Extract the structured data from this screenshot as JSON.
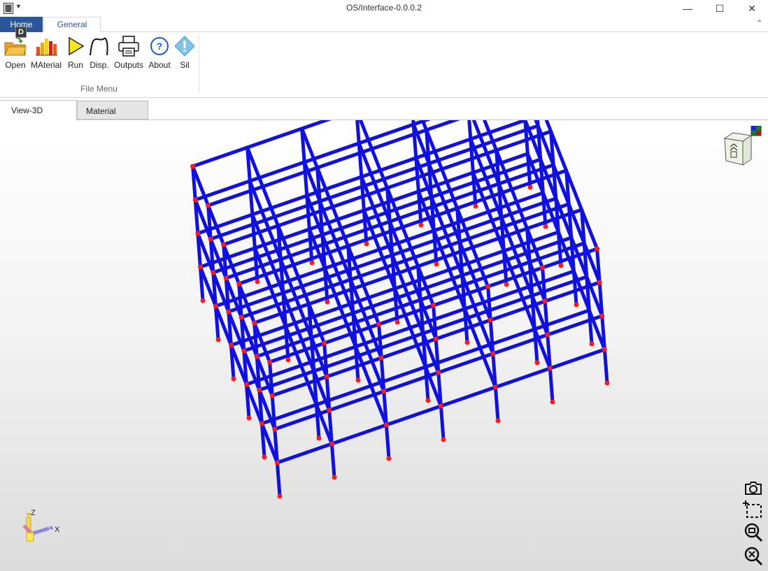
{
  "window": {
    "title": "OS/Interface-0.0.0.2",
    "minimize": "—",
    "maximize": "☐",
    "close": "✕"
  },
  "ribbon": {
    "tabs": [
      {
        "label": "Home"
      },
      {
        "label": "General"
      }
    ],
    "keytip": "D",
    "buttons": [
      {
        "label": "Open",
        "icon": "open-folder-icon"
      },
      {
        "label": "MAterial",
        "icon": "material-chart-icon"
      },
      {
        "label": "Run",
        "icon": "run-play-icon"
      },
      {
        "label": "Disp.",
        "icon": "displacement-curve-icon"
      },
      {
        "label": "Outputs",
        "icon": "printer-icon"
      },
      {
        "label": "About",
        "icon": "question-circle-icon"
      },
      {
        "label": "Sil",
        "icon": "info-diamond-icon"
      }
    ],
    "group_label": "File Menu",
    "collapse_icon": "⌃"
  },
  "document_tabs": [
    {
      "label": "View-3D",
      "active": true
    },
    {
      "label": "Material",
      "active": false
    }
  ],
  "viewport": {
    "axis_labels": {
      "z": "Z",
      "x": "X"
    },
    "tools": [
      "camera-icon",
      "zoom-window-icon",
      "zoom-icon",
      "zoom-extents-icon"
    ],
    "colors": {
      "member": "#1010e0",
      "node": "#ff1a1a",
      "accent": "#2b579a"
    }
  }
}
